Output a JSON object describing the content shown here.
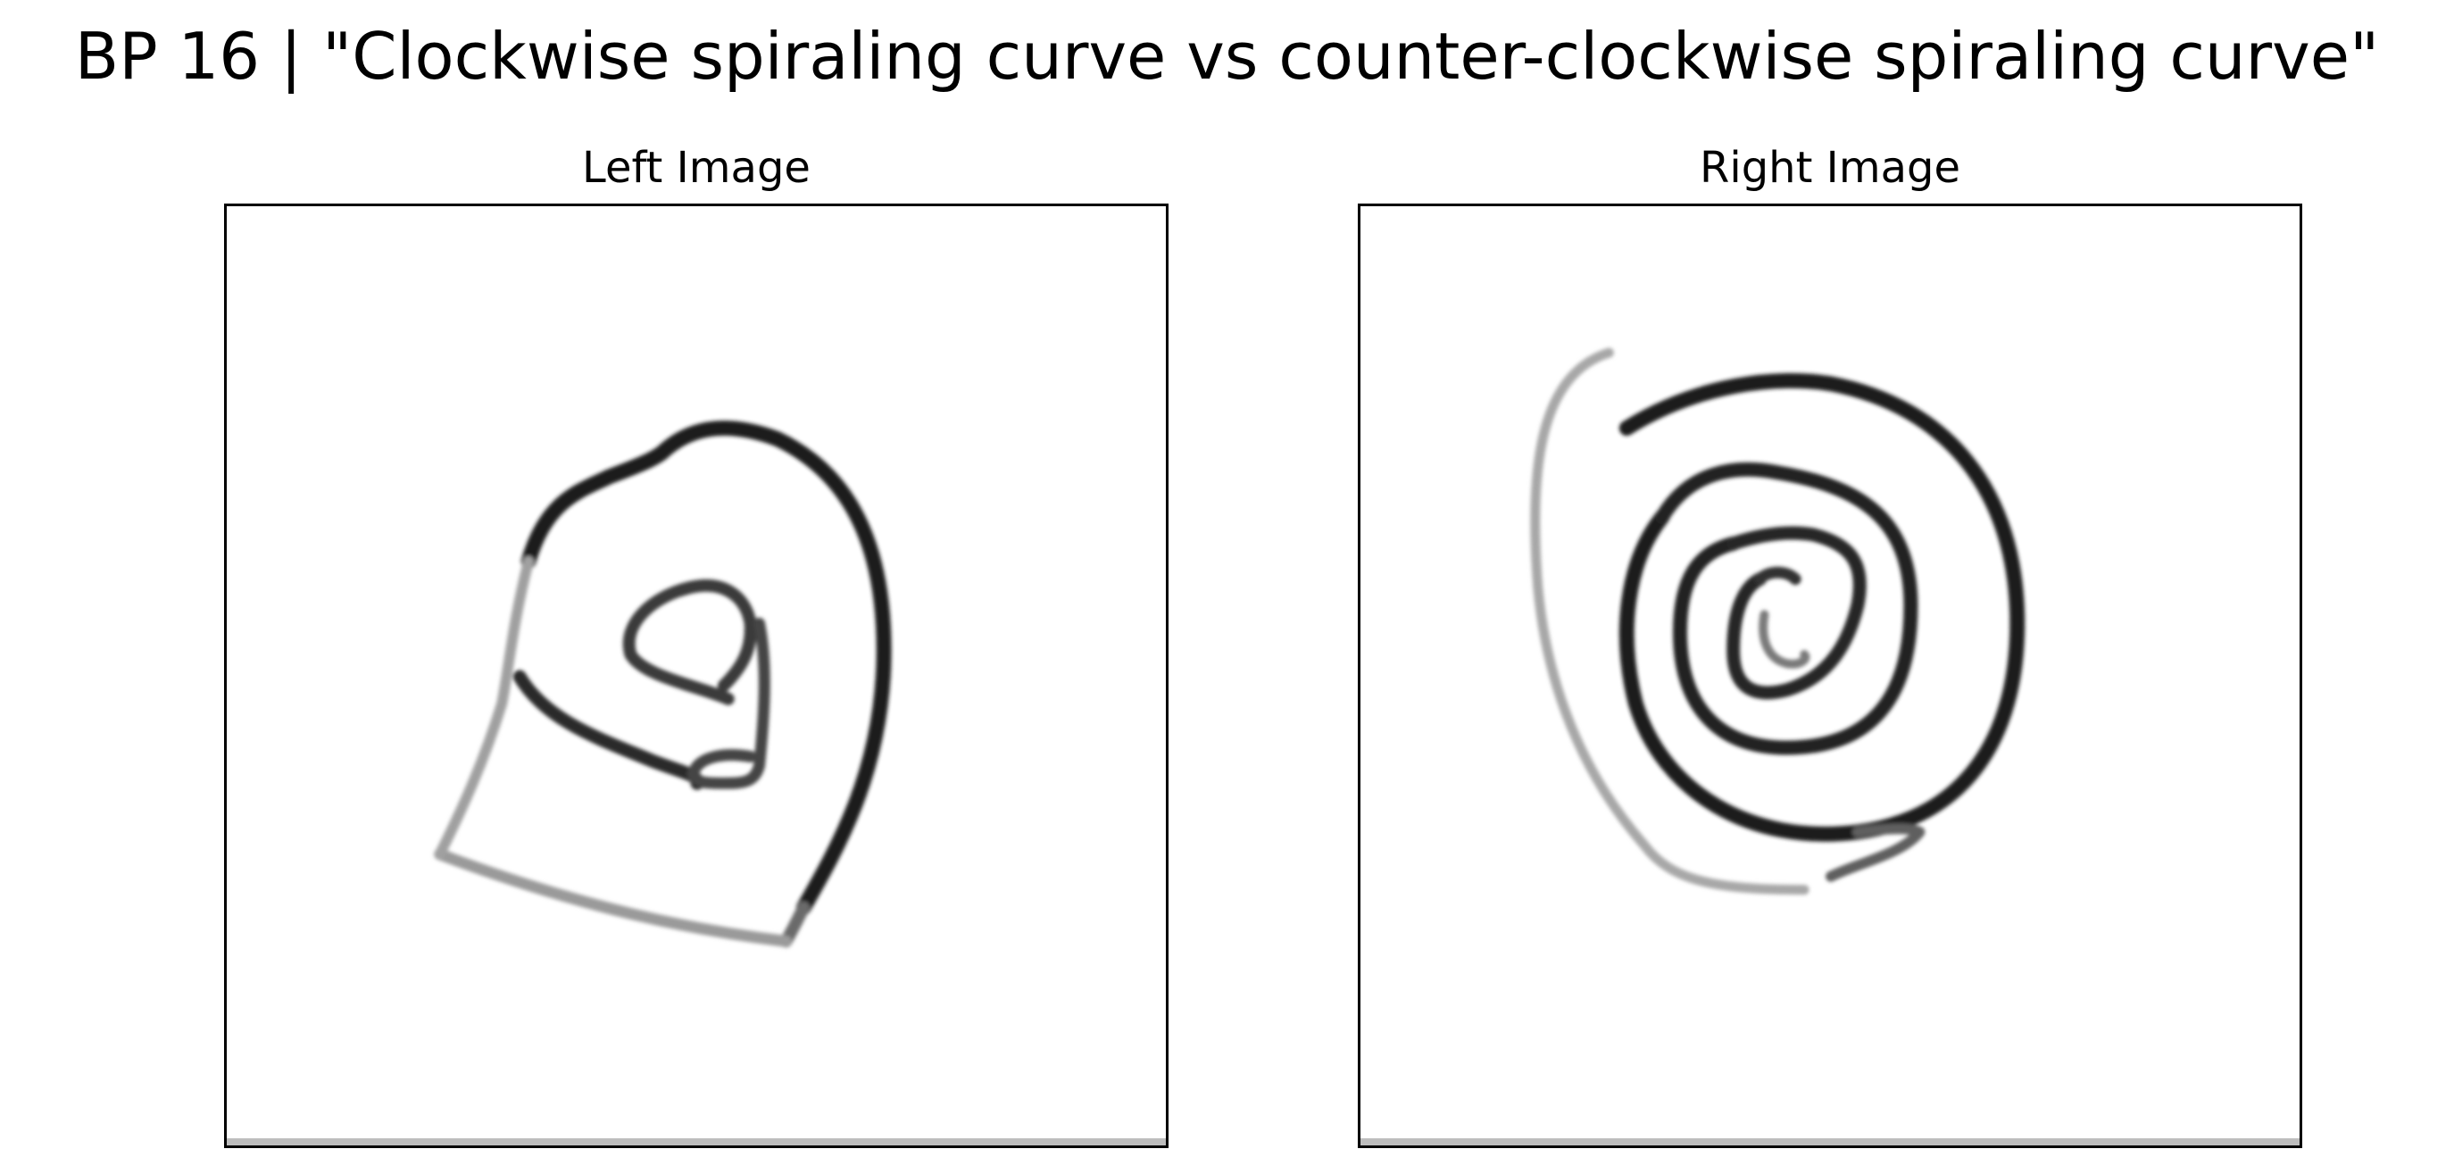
{
  "figure": {
    "title": "BP 16 | \"Clockwise spiraling curve vs counter-clockwise spiraling curve\"",
    "panels": [
      {
        "title": "Left Image",
        "drawing": "clockwise-spiral-sketch",
        "stroke_color": "#1a1a1a"
      },
      {
        "title": "Right Image",
        "drawing": "counter-clockwise-spiral-sketch",
        "stroke_color": "#1a1a1a"
      }
    ]
  }
}
